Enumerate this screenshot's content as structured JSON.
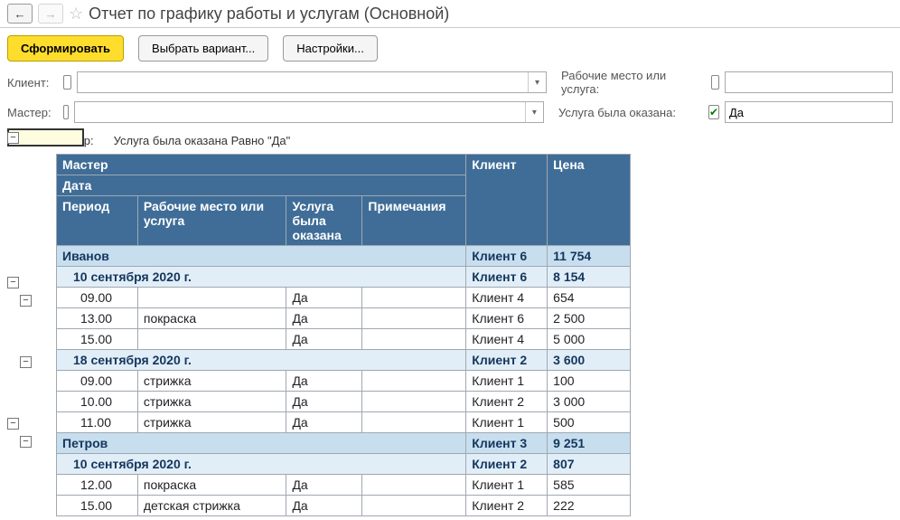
{
  "title": "Отчет по графику работы и услугам (Основной)",
  "toolbar": {
    "generate": "Сформировать",
    "variant": "Выбрать вариант...",
    "settings": "Настройки..."
  },
  "filters": {
    "client_label": "Клиент:",
    "master_label": "Мастер:",
    "workplace_label": "Рабочие место или услуга:",
    "service_done_label": "Услуга была оказана:",
    "service_done_value": "Да"
  },
  "report": {
    "filter_caption": "Отбор:",
    "filter_text": "Услуга была оказана Равно \"Да\"",
    "headers": {
      "master": "Мастер",
      "date": "Дата",
      "period": "Период",
      "workplace": "Рабочие место или услуга",
      "service_done": "Услуга была оказана",
      "notes": "Примечания",
      "client": "Клиент",
      "price": "Цена"
    },
    "rows": [
      {
        "type": "master",
        "name": "Иванов",
        "client": "Клиент 6",
        "price": "11 754"
      },
      {
        "type": "date",
        "name": "10 сентября 2020 г.",
        "client": "Клиент 6",
        "price": "8 154"
      },
      {
        "type": "detail",
        "period": "09.00",
        "work": "",
        "serv": "Да",
        "notes": "",
        "client": "Клиент 4",
        "price": "654"
      },
      {
        "type": "detail",
        "period": "13.00",
        "work": "покраска",
        "serv": "Да",
        "notes": "",
        "client": "Клиент 6",
        "price": "2 500"
      },
      {
        "type": "detail",
        "period": "15.00",
        "work": "",
        "serv": "Да",
        "notes": "",
        "client": "Клиент 4",
        "price": "5 000"
      },
      {
        "type": "date",
        "name": "18 сентября 2020 г.",
        "client": "Клиент 2",
        "price": "3 600"
      },
      {
        "type": "detail",
        "period": "09.00",
        "work": "стрижка",
        "serv": "Да",
        "notes": "",
        "client": "Клиент 1",
        "price": "100"
      },
      {
        "type": "detail",
        "period": "10.00",
        "work": "стрижка",
        "serv": "Да",
        "notes": "",
        "client": "Клиент 2",
        "price": "3 000"
      },
      {
        "type": "detail",
        "period": "11.00",
        "work": "стрижка",
        "serv": "Да",
        "notes": "",
        "client": "Клиент 1",
        "price": "500"
      },
      {
        "type": "master",
        "name": "Петров",
        "client": "Клиент 3",
        "price": "9 251"
      },
      {
        "type": "date",
        "name": "10 сентября 2020 г.",
        "client": "Клиент 2",
        "price": "807"
      },
      {
        "type": "detail",
        "period": "12.00",
        "work": "покраска",
        "serv": "Да",
        "notes": "",
        "client": "Клиент 1",
        "price": "585"
      },
      {
        "type": "detail",
        "period": "15.00",
        "work": "детская стрижка",
        "serv": "Да",
        "notes": "",
        "client": "Клиент 2",
        "price": "222"
      }
    ]
  },
  "icons": {
    "minus": "−",
    "back": "←",
    "fwd": "→",
    "dd": "▾",
    "star": "☆"
  }
}
